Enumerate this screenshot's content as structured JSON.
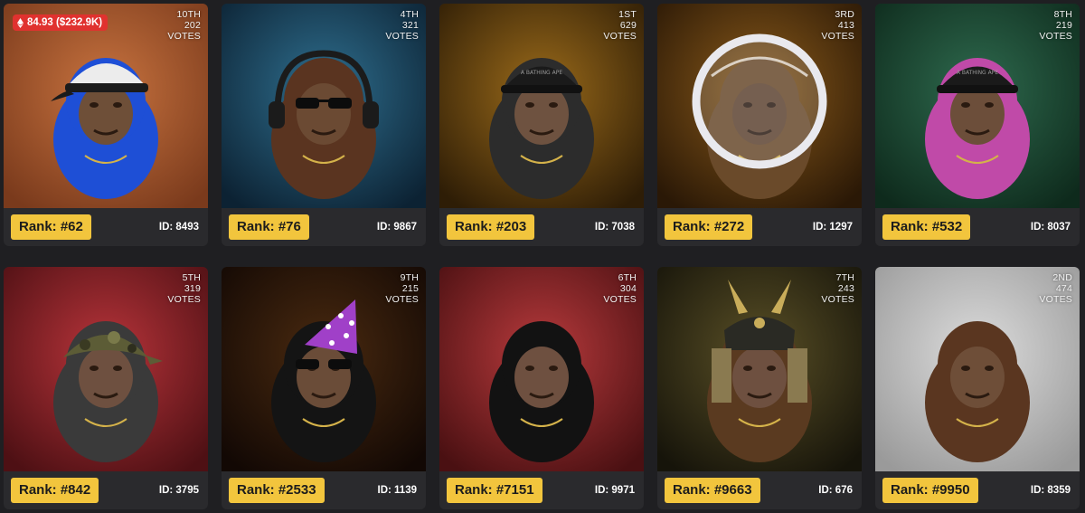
{
  "cards": [
    {
      "place": "10TH",
      "votes": "202",
      "votes_label": "VOTES",
      "rank": "Rank: #62",
      "id_label": "ID: 8493",
      "price": "84.93 ($232.9K)",
      "bg": "#c8733f",
      "bg_edge": "#7a3a1c",
      "fur": "#1e4fd6",
      "face": "#6e4f38",
      "accessory": "cap-white",
      "accent": "#e8e8e8"
    },
    {
      "place": "4TH",
      "votes": "321",
      "votes_label": "VOTES",
      "rank": "Rank: #76",
      "id_label": "ID: 9867",
      "bg": "#2f6f8f",
      "bg_edge": "#0c2233",
      "fur": "#5a3420",
      "face": "#6b4a33",
      "accessory": "headphones",
      "accent": "#222222"
    },
    {
      "place": "1ST",
      "votes": "629",
      "votes_label": "VOTES",
      "rank": "Rank: #203",
      "id_label": "ID: 7038",
      "bg": "#9a6a1a",
      "bg_edge": "#2e1d06",
      "fur": "#2c2c2c",
      "face": "#6e5240",
      "accessory": "cap-black",
      "accent": "#1a1a1a"
    },
    {
      "place": "3RD",
      "votes": "413",
      "votes_label": "VOTES",
      "rank": "Rank: #272",
      "id_label": "ID: 1297",
      "bg": "#8a5a1a",
      "bg_edge": "#2a1806",
      "fur": "#6a4a2a",
      "face": "#5e4430",
      "accessory": "helmet",
      "accent": "#d8d8d8"
    },
    {
      "place": "8TH",
      "votes": "219",
      "votes_label": "VOTES",
      "rank": "Rank: #532",
      "id_label": "ID: 8037",
      "bg": "#2e6a4e",
      "bg_edge": "#0e2a1c",
      "fur": "#c04aa8",
      "face": "#6c4e3a",
      "accessory": "cap-black",
      "accent": "#1a1a1a"
    },
    {
      "place": "5TH",
      "votes": "319",
      "votes_label": "VOTES",
      "rank": "Rank: #842",
      "id_label": "ID: 3795",
      "bg": "#b8343a",
      "bg_edge": "#4e1014",
      "fur": "#3a3a3a",
      "face": "#6e5040",
      "accessory": "bandana",
      "accent": "#5a5a38"
    },
    {
      "place": "9TH",
      "votes": "215",
      "votes_label": "VOTES",
      "rank": "Rank: #2533",
      "id_label": "ID: 1139",
      "bg": "#4a2a10",
      "bg_edge": "#120804",
      "fur": "#141414",
      "face": "#6a4c38",
      "accessory": "party-hat",
      "accent": "#a040c8"
    },
    {
      "place": "6TH",
      "votes": "304",
      "votes_label": "VOTES",
      "rank": "Rank: #7151",
      "id_label": "ID: 9971",
      "bg": "#b83a3c",
      "bg_edge": "#4a1012",
      "fur": "#121212",
      "face": "#6e5040",
      "accessory": "none",
      "accent": "#dddddd"
    },
    {
      "place": "7TH",
      "votes": "243",
      "votes_label": "VOTES",
      "rank": "Rank: #9663",
      "id_label": "ID: 676",
      "bg": "#5a5026",
      "bg_edge": "#16140a",
      "fur": "#5a3a20",
      "face": "#6e5040",
      "accessory": "samurai",
      "accent": "#c9ad5a"
    },
    {
      "place": "2ND",
      "votes": "474",
      "votes_label": "VOTES",
      "rank": "Rank: #9950",
      "id_label": "ID: 8359",
      "bg": "#dcdcdc",
      "bg_edge": "#9a9a9a",
      "fur": "#5a3620",
      "face": "#6e4e38",
      "accessory": "none",
      "accent": "#dddddd"
    }
  ]
}
